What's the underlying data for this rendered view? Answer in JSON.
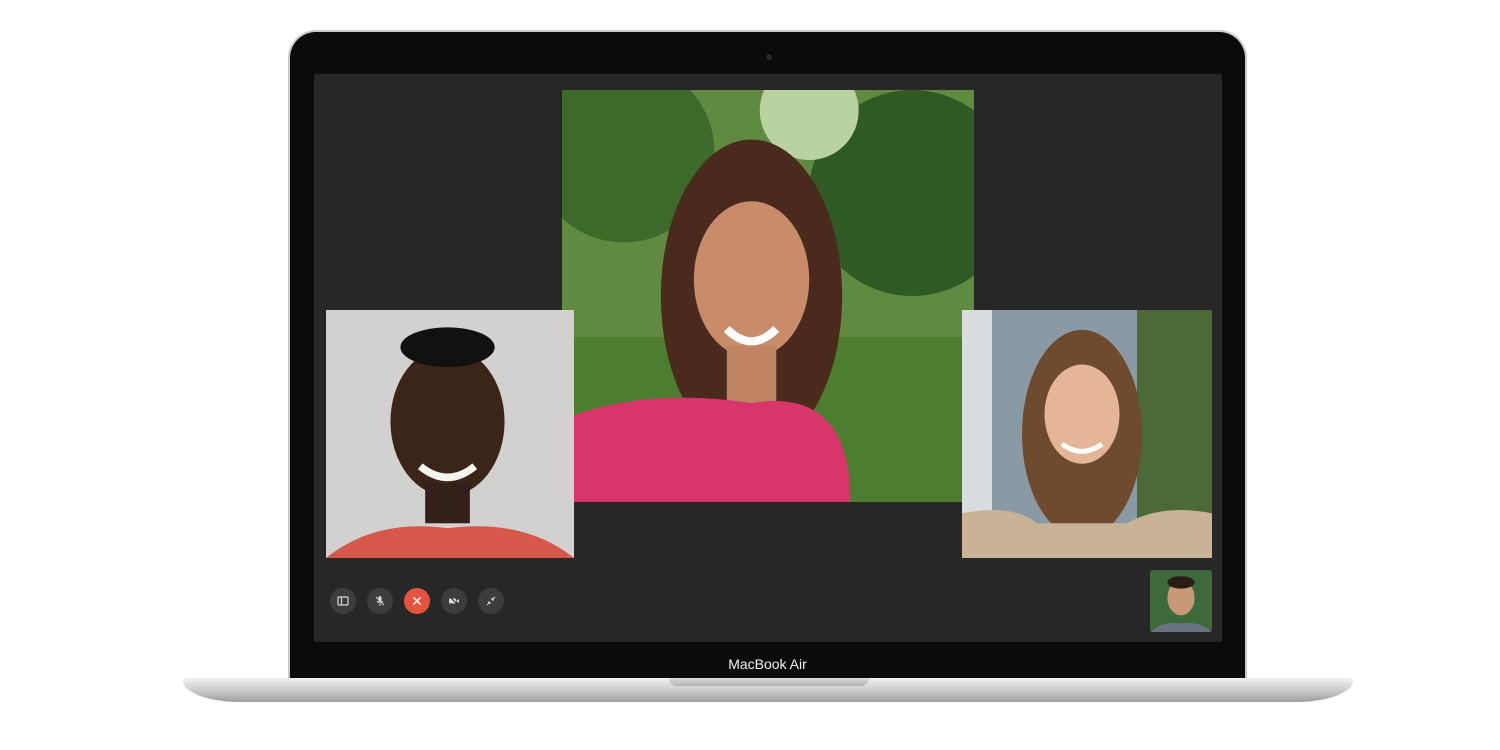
{
  "laptop": {
    "model_label": "MacBook Air"
  },
  "facetime": {
    "controls": [
      {
        "id": "sidebar",
        "icon": "sidebar-icon"
      },
      {
        "id": "mute",
        "icon": "microphone-mute-icon"
      },
      {
        "id": "end_call",
        "icon": "close-icon",
        "glyph": "✕",
        "color": "#e5533f"
      },
      {
        "id": "camera",
        "icon": "video-camera-off-icon"
      },
      {
        "id": "fullscreen",
        "icon": "collapse-arrows-icon"
      }
    ],
    "participants": [
      {
        "position": "center"
      },
      {
        "position": "left"
      },
      {
        "position": "right"
      },
      {
        "position": "self-preview"
      }
    ],
    "background_color": "#272727"
  }
}
